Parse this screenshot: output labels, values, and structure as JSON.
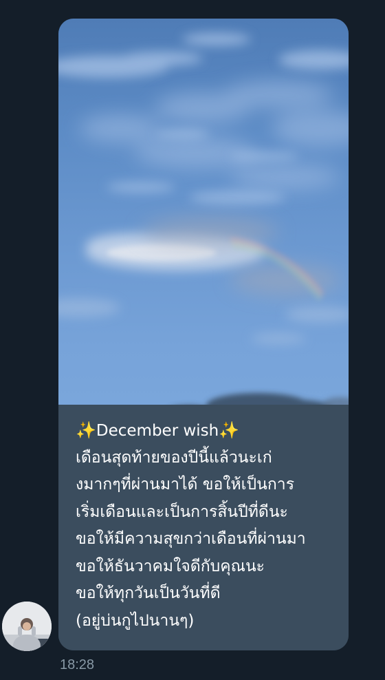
{
  "message": {
    "caption": {
      "title_prefix_icon": "sparkles-icon",
      "title_text": "December wish",
      "title_suffix_icon": "sparkles-icon",
      "lines": [
        "เดือนสุดท้ายของปีนี้แล้วนะเก่",
        "งมากๆที่ผ่านมาได้ ขอให้เป็นการ",
        "เริ่มเดือนและเป็นการสิ้นปีที่ดีนะ",
        "ขอให้มีความสุขกว่าเดือนที่ผ่านมา",
        "ขอให้ธันวาคมใจดีกับคุณนะ",
        "ขอให้ทุกวันเป็นวันที่ดี",
        "(อยู่บ่นกูไปนานๆ)"
      ]
    },
    "image": {
      "subject": "blue sky with clouds and a faint rainbow",
      "icon": "photo-image"
    },
    "timestamp": "18:28"
  },
  "sender": {
    "avatar_icon": "user-avatar"
  },
  "colors": {
    "background": "#141e29",
    "bubble": "#3b4d5e",
    "text": "#ffffff",
    "timestamp": "#8899a6",
    "sparkle": "#f8c646"
  }
}
